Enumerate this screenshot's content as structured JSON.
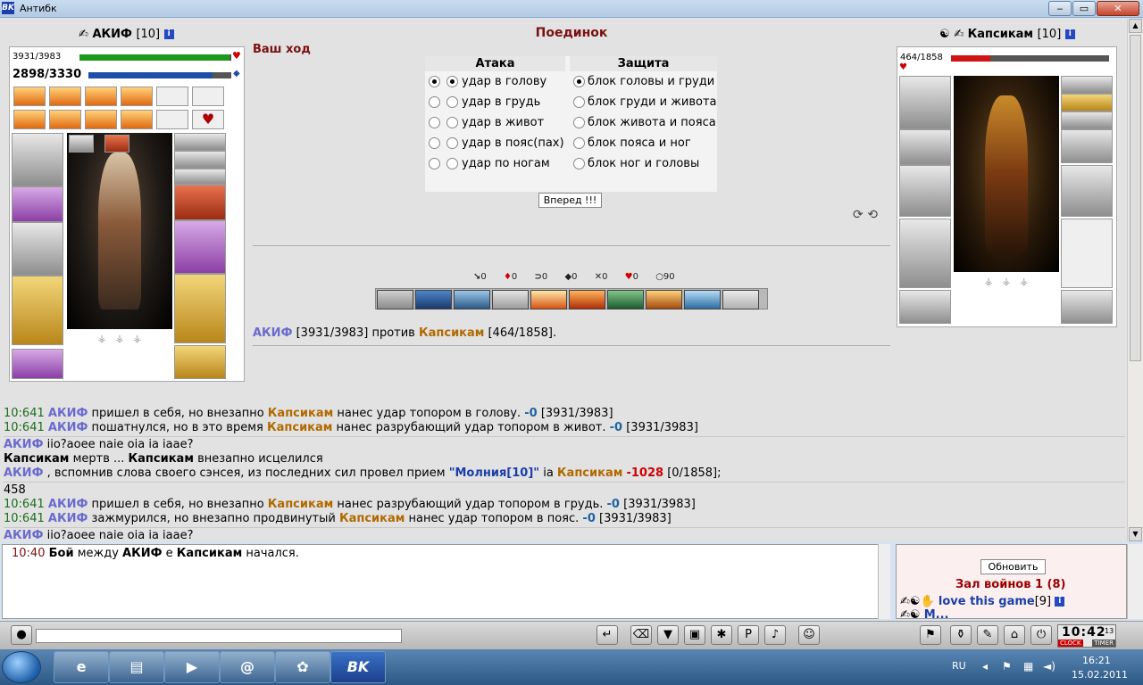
{
  "window": {
    "title": "Антибк",
    "icon_text": "BK",
    "min": "‒",
    "max": "▭",
    "close": "✕"
  },
  "battle": {
    "title": "Поединок",
    "your_turn": "Ваш ход"
  },
  "left_player": {
    "name": "АКИФ",
    "level": "[10]",
    "hp_text": "3931/3983",
    "hp_fraction": 0.987,
    "mana_text": "2898/3330",
    "mana_fraction": 0.87
  },
  "right_player": {
    "name": "Капсикам",
    "level": "[10]",
    "hp_text": "464/1858",
    "hp_fraction": 0.25
  },
  "attack": {
    "header": "Атака",
    "options": [
      "удар в голову",
      "удар в грудь",
      "удар в живот",
      "удар в пояс(пах)",
      "удар по ногам"
    ],
    "selected_index": 0
  },
  "defense": {
    "header": "Защита",
    "options": [
      "блок головы и груди",
      "блок груди и живота",
      "блок живота и пояса",
      "блок пояса и ног",
      "блок ног и головы"
    ],
    "selected_index": 0
  },
  "forward_button": "Вперед !!!",
  "counters": [
    "0",
    "0",
    "0",
    "0",
    "0",
    "0",
    "90"
  ],
  "counter_icons": [
    "↘",
    "♦",
    "⊃",
    "◆",
    "✕",
    "♥",
    "○"
  ],
  "vs_line": {
    "a": "АКИФ",
    "a_hp": "[3931/3983]",
    "mid": "против",
    "b": "Капсикам",
    "b_hp": "[464/1858]."
  },
  "log": {
    "l1": {
      "time": "10:641",
      "who": "АКИФ",
      "t1": "пришел в себя, но внезапно",
      "who2": "Капсикам",
      "t2": "нанес удар топором в голову.",
      "dmg": "-0",
      "hp": "[3931/3983]"
    },
    "l2": {
      "time": "10:641",
      "who": "АКИФ",
      "t1": "пошатнулся, но в это время",
      "who2": "Капсикам",
      "t2": "нанес разрубающий удар топором в живот.",
      "dmg": "-0",
      "hp": "[3931/3983]"
    },
    "l3": {
      "who": "АКИФ",
      "text": "iio?aoee naie oia ia iaae?"
    },
    "l4": {
      "who": "Капсикам",
      "t1": "мертв ...",
      "who2": "Капсикам",
      "t2": "внезапно исцелился"
    },
    "l5": {
      "who": "АКИФ",
      "t1": ", вспомнив слова своего сэнсея, из последних сил провел прием",
      "skill": "\"Молния[10]\"",
      "t2": "ia",
      "who2": "Капсикам",
      "dmg": "-1028",
      "hp": "[0/1858];"
    },
    "l6": {
      "text": "458"
    },
    "l7": {
      "time": "10:641",
      "who": "АКИФ",
      "t1": "пришел в себя, но внезапно",
      "who2": "Капсикам",
      "t2": "нанес разрубающий удар топором в грудь.",
      "dmg": "-0",
      "hp": "[3931/3983]"
    },
    "l8": {
      "time": "10:641",
      "who": "АКИФ",
      "t1": "зажмурился, но внезапно продвинутый",
      "who2": "Капсикам",
      "t2": "нанес удар топором в пояс.",
      "dmg": "-0",
      "hp": "[3931/3983]"
    },
    "l9": {
      "who": "АКИФ",
      "text": "iio?aoee naie oia ia iaae?"
    }
  },
  "chat": {
    "time": "10:40",
    "t1": "Бой",
    "t2": "между",
    "a": "АКИФ",
    "t3": "е",
    "b": "Капсикам",
    "t4": "начался."
  },
  "room": {
    "refresh": "Обновить",
    "hall": "Зал войнов 1 (8)",
    "user": "love this game",
    "user_level": "[9]",
    "user2": "M..."
  },
  "clock": {
    "time": "10:42",
    "sec": "13",
    "label": "CLOCK",
    "label2": "TIMER"
  },
  "taskbar": {
    "lang": "RU",
    "time": "16:21",
    "date": "15.02.2011",
    "bk_label": "BK"
  }
}
